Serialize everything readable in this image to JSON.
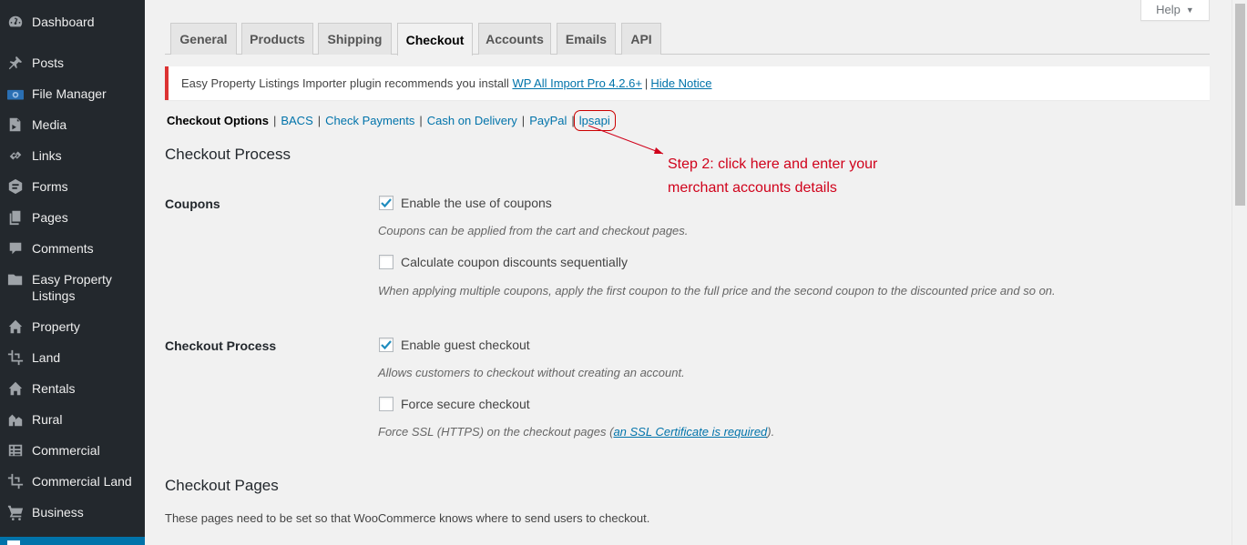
{
  "sidebar": {
    "items": [
      {
        "label": "Dashboard",
        "icon": "dashboard-icon"
      },
      {
        "label": "Posts",
        "icon": "pin-icon"
      },
      {
        "label": "File Manager",
        "icon": "file-manager-icon"
      },
      {
        "label": "Media",
        "icon": "media-icon"
      },
      {
        "label": "Links",
        "icon": "link-icon"
      },
      {
        "label": "Forms",
        "icon": "forms-icon"
      },
      {
        "label": "Pages",
        "icon": "pages-icon"
      },
      {
        "label": "Comments",
        "icon": "comment-icon"
      },
      {
        "label": "Easy Property Listings",
        "icon": "folder-icon"
      },
      {
        "label": "Property",
        "icon": "home-icon"
      },
      {
        "label": "Land",
        "icon": "crop-icon"
      },
      {
        "label": "Rentals",
        "icon": "home-icon"
      },
      {
        "label": "Rural",
        "icon": "rural-icon"
      },
      {
        "label": "Commercial",
        "icon": "commercial-icon"
      },
      {
        "label": "Commercial Land",
        "icon": "crop-icon"
      },
      {
        "label": "Business",
        "icon": "cart-icon"
      }
    ]
  },
  "help": {
    "label": "Help"
  },
  "tabs": [
    {
      "label": "General"
    },
    {
      "label": "Products"
    },
    {
      "label": "Shipping"
    },
    {
      "label": "Checkout",
      "active": true
    },
    {
      "label": "Accounts"
    },
    {
      "label": "Emails"
    },
    {
      "label": "API"
    }
  ],
  "notice": {
    "text": "Easy Property Listings Importer plugin recommends you install",
    "link": "WP All Import Pro 4.2.6+",
    "separator": "|",
    "dismiss": "Hide Notice"
  },
  "subnav": {
    "current": "Checkout Options",
    "links": [
      "BACS",
      "Check Payments",
      "Cash on Delivery",
      "PayPal",
      "lpsapi"
    ],
    "separator": "|"
  },
  "annotation": {
    "line1": "Step 2: click here and enter your",
    "line2": "merchant accounts details",
    "color": "#d0021b"
  },
  "checkout_process": {
    "title": "Checkout Process",
    "coupons": {
      "label": "Coupons",
      "enable": {
        "label": "Enable the use of coupons",
        "checked": true
      },
      "enable_desc": "Coupons can be applied from the cart and checkout pages.",
      "sequential": {
        "label": "Calculate coupon discounts sequentially",
        "checked": false
      },
      "sequential_desc": "When applying multiple coupons, apply the first coupon to the full price and the second coupon to the discounted price and so on."
    },
    "process": {
      "label": "Checkout Process",
      "guest": {
        "label": "Enable guest checkout",
        "checked": true
      },
      "guest_desc": "Allows customers to checkout without creating an account.",
      "secure": {
        "label": "Force secure checkout",
        "checked": false
      },
      "secure_desc_before": "Force SSL (HTTPS) on the checkout pages (",
      "secure_desc_link": "an SSL Certificate is required",
      "secure_desc_after": ")."
    }
  },
  "checkout_pages": {
    "title": "Checkout Pages",
    "desc": "These pages need to be set so that WooCommerce knows where to send users to checkout."
  }
}
